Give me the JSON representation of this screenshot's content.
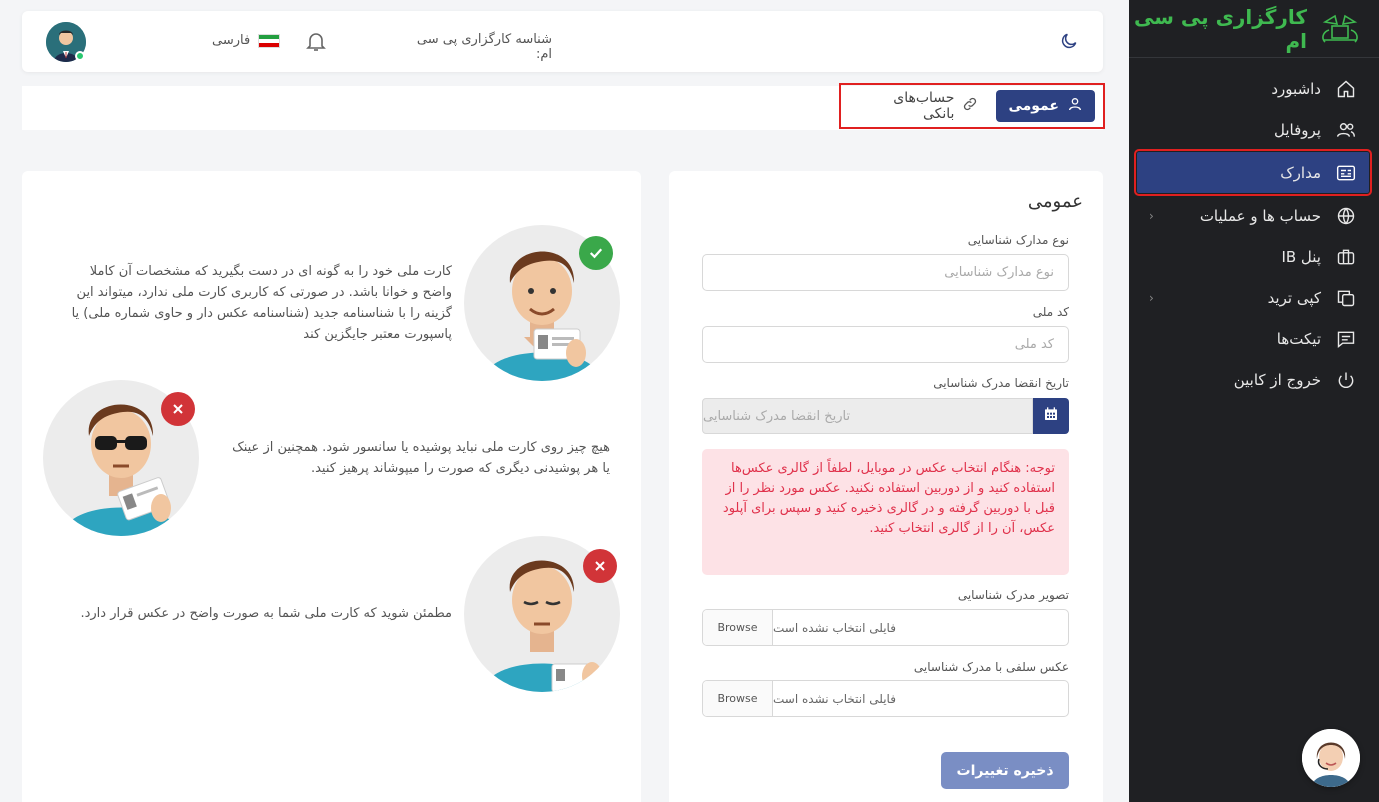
{
  "brand": {
    "name": "کارگزاری پی سی ام",
    "color": "#3fb950"
  },
  "sidebar": {
    "items": [
      {
        "label": "داشبورد",
        "icon": "home-icon"
      },
      {
        "label": "پروفایل",
        "icon": "users-icon"
      },
      {
        "label": "مدارک",
        "icon": "id-card-icon",
        "active": true
      },
      {
        "label": "حساب ها و عملیات",
        "icon": "globe-icon",
        "expandable": true
      },
      {
        "label": "پنل IB",
        "icon": "briefcase-icon"
      },
      {
        "label": "کپی ترید",
        "icon": "copy-icon",
        "expandable": true
      },
      {
        "label": "تیکت‌ها",
        "icon": "message-icon"
      },
      {
        "label": "خروج از کابین",
        "icon": "power-icon"
      }
    ]
  },
  "header": {
    "broker_id": "شناسه کارگزاری پی سی ام:",
    "language": "فارسی"
  },
  "tabs": {
    "general": "عمومی",
    "bank": "حساب‌های بانکی"
  },
  "form": {
    "title": "عمومی",
    "doc_type_label": "نوع مدارک شناسایی",
    "doc_type_placeholder": "نوع مدارک شناسایی",
    "national_code_label": "کد ملی",
    "national_code_placeholder": "کد ملی",
    "expiry_label": "تاریخ انقضا مدرک شناسایی",
    "expiry_placeholder": "تاریخ انقضا مدرک شناسایی",
    "alert": "توجه: هنگام انتخاب عکس در موبایل، لطفاً از گالری عکس‌ها استفاده کنید و از دوربین استفاده نکنید. عکس مورد نظر را از قبل با دوربین گرفته و در گالری ذخیره کنید و سپس برای آپلود عکس، آن را از گالری انتخاب کنید.",
    "doc_image_label": "تصویر مدرک شناسایی",
    "selfie_label": "عکس سلفی با مدرک شناسایی",
    "no_file": "فایلی انتخاب نشده است",
    "browse": "Browse",
    "save": "ذخیره تغییرات"
  },
  "guide": {
    "tip1": "کارت ملی خود را به گونه ای در دست بگیرید که مشخصات آن کاملا واضح و خوانا باشد. در صورتی که کاربری کارت ملی ندارد، میتواند این گزینه را با شناسنامه جدید (شناسنامه عکس دار و حاوی شماره ملی) یا پاسپورت معتبر جایگزین کند",
    "tip2": "هیچ چیز روی کارت ملی نباید پوشیده یا سانسور شود. همچنین از عینک یا هر پوشیدنی دیگری که صورت را میپوشاند پرهیز کنید.",
    "tip3": "مطمئن شوید که کارت ملی شما به صورت واضح در عکس قرار دارد."
  },
  "colors": {
    "primary": "#2d4182",
    "success": "#3aa84a",
    "danger": "#d13438",
    "alert_bg": "#fde2e6"
  }
}
